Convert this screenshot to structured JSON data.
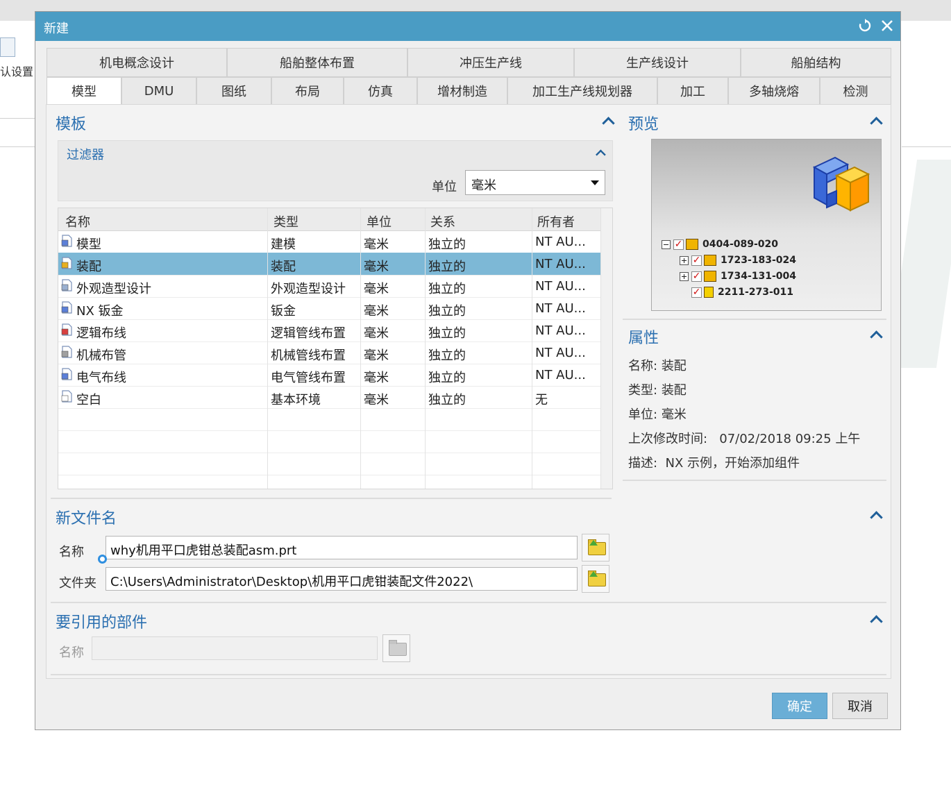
{
  "background": {
    "left_text": "认设置"
  },
  "dialog": {
    "title": "新建",
    "refresh_icon": "refresh-icon",
    "close_icon": "close-icon",
    "tabs_row1": [
      "机电概念设计",
      "船舶整体布置",
      "冲压生产线",
      "生产线设计",
      "船舶结构"
    ],
    "tabs_row2": [
      "模型",
      "DMU",
      "图纸",
      "布局",
      "仿真",
      "增材制造",
      "加工生产线规划器",
      "加工",
      "多轴烧熔",
      "检测"
    ],
    "active_tab": "模型",
    "template": {
      "title": "模板",
      "filter": {
        "title": "过滤器",
        "unit_label": "单位",
        "unit_value": "毫米"
      },
      "table": {
        "headers": [
          "名称",
          "类型",
          "单位",
          "关系",
          "所有者"
        ],
        "rows": [
          {
            "name": "模型",
            "type": "建模",
            "unit": "毫米",
            "relation": "独立的",
            "owner": "NT AU...",
            "icon": "model-template-icon"
          },
          {
            "name": "装配",
            "type": "装配",
            "unit": "毫米",
            "relation": "独立的",
            "owner": "NT AU...",
            "icon": "assembly-template-icon",
            "selected": true
          },
          {
            "name": "外观造型设计",
            "type": "外观造型设计",
            "unit": "毫米",
            "relation": "独立的",
            "owner": "NT AU...",
            "icon": "shape-studio-template-icon"
          },
          {
            "name": "NX 钣金",
            "type": "钣金",
            "unit": "毫米",
            "relation": "独立的",
            "owner": "NT AU...",
            "icon": "sheet-metal-template-icon"
          },
          {
            "name": "逻辑布线",
            "type": "逻辑管线布置",
            "unit": "毫米",
            "relation": "独立的",
            "owner": "NT AU...",
            "icon": "logical-routing-template-icon"
          },
          {
            "name": "机械布管",
            "type": "机械管线布置",
            "unit": "毫米",
            "relation": "独立的",
            "owner": "NT AU...",
            "icon": "mechanical-routing-template-icon"
          },
          {
            "name": "电气布线",
            "type": "电气管线布置",
            "unit": "毫米",
            "relation": "独立的",
            "owner": "NT AU...",
            "icon": "electrical-routing-template-icon"
          },
          {
            "name": "空白",
            "type": "基本环境",
            "unit": "毫米",
            "relation": "独立的",
            "owner": "无",
            "icon": "blank-template-icon"
          }
        ]
      }
    },
    "preview": {
      "title": "预览",
      "tree": [
        {
          "label": "0404-089-020",
          "expander": "minus",
          "icon": "assembly-icon"
        },
        {
          "label": "1723-183-024",
          "expander": "plus",
          "icon": "assembly-icon"
        },
        {
          "label": "1734-131-004",
          "expander": "plus",
          "icon": "assembly-icon"
        },
        {
          "label": "2211-273-011",
          "expander": "none",
          "icon": "part-icon"
        }
      ]
    },
    "properties": {
      "title": "属性",
      "name_label": "名称:",
      "name_value": "装配",
      "type_label": "类型:",
      "type_value": "装配",
      "unit_label": "单位:",
      "unit_value": "毫米",
      "modified_label": "上次修改时间:",
      "modified_value": "07/02/2018 09:25 上午",
      "desc_label": "描述:",
      "desc_value": "NX 示例，开始添加组件"
    },
    "new_filename": {
      "title": "新文件名",
      "name_label": "名称",
      "name_value": "why机用平口虎钳总装配asm.prt",
      "folder_label": "文件夹",
      "folder_value": "C:\\Users\\Administrator\\Desktop\\机用平口虎钳装配文件2022\\"
    },
    "referenced_part": {
      "title": "要引用的部件",
      "name_label": "名称",
      "name_value": ""
    },
    "buttons": {
      "ok": "确定",
      "cancel": "取消"
    },
    "colors": {
      "titlebar": "#4a9cc4",
      "section_title": "#2a6fb0",
      "selected_row": "#7db8d6",
      "ok_button": "#6aaed6"
    }
  }
}
